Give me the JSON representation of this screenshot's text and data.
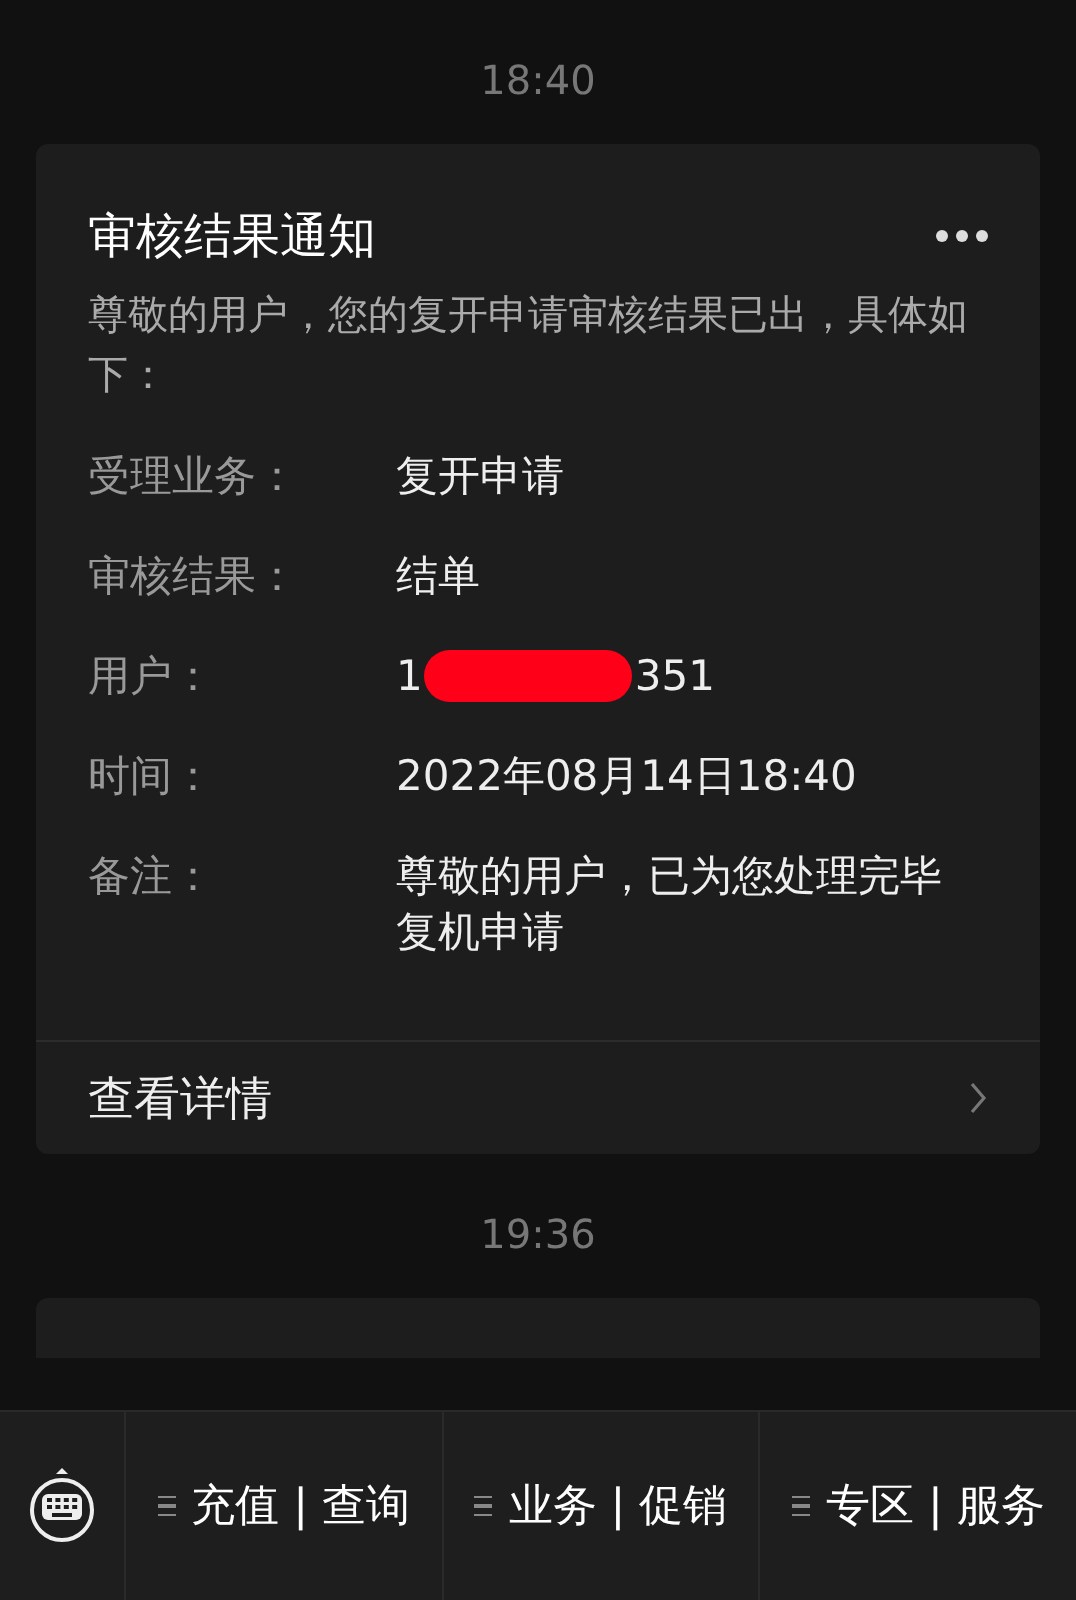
{
  "messages": [
    {
      "time": "18:40",
      "card": {
        "title": "审核结果通知",
        "intro": "尊敬的用户，您的复开申请审核结果已出，具体如下：",
        "fields": [
          {
            "label": "受理业务：",
            "value": "复开申请"
          },
          {
            "label": "审核结果：",
            "value": "结单"
          },
          {
            "label": "用户：",
            "value": "1",
            "value_end": "351",
            "redacted": true
          },
          {
            "label": "时间：",
            "value": "2022年08月14日18:40"
          },
          {
            "label": "备注：",
            "value": "尊敬的用户，已为您处理完毕复机申请"
          }
        ],
        "link": "查看详情"
      }
    },
    {
      "time": "19:36"
    }
  ],
  "menu": [
    {
      "label": "充值 | 查询"
    },
    {
      "label": "业务 | 促销"
    },
    {
      "label": "专区 | 服务"
    }
  ]
}
